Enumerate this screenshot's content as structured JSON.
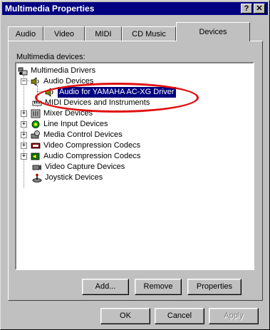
{
  "window": {
    "title": "Multimedia Properties",
    "help_btn": "?",
    "close_btn": "✕"
  },
  "tabs": [
    {
      "label": "Audio"
    },
    {
      "label": "Video"
    },
    {
      "label": "MIDI"
    },
    {
      "label": "CD Music"
    },
    {
      "label": "Devices"
    }
  ],
  "devices_label": "Multimedia devices:",
  "tree": [
    {
      "label": "Multimedia Drivers",
      "icon": "multimedia-drivers-icon"
    },
    {
      "label": "Audio Devices",
      "icon": "speaker-icon"
    },
    {
      "label": "Audio for YAMAHA AC-XG Driver",
      "icon": "speaker-icon",
      "selected": true
    },
    {
      "label": "MIDI Devices and Instruments",
      "icon": "midi-icon"
    },
    {
      "label": "Mixer Devices",
      "icon": "mixer-icon"
    },
    {
      "label": "Line Input Devices",
      "icon": "line-input-icon"
    },
    {
      "label": "Media Control Devices",
      "icon": "media-control-icon"
    },
    {
      "label": "Video Compression Codecs",
      "icon": "video-codec-icon"
    },
    {
      "label": "Audio Compression Codecs",
      "icon": "audio-codec-icon"
    },
    {
      "label": "Video Capture Devices",
      "icon": "video-capture-icon"
    },
    {
      "label": "Joystick Devices",
      "icon": "joystick-icon"
    }
  ],
  "buttons": {
    "add": "Add...",
    "remove": "Remove",
    "properties": "Properties",
    "ok": "OK",
    "cancel": "Cancel",
    "apply": "Apply"
  },
  "highlight_color": "#e01010",
  "selection_color": "#000080"
}
